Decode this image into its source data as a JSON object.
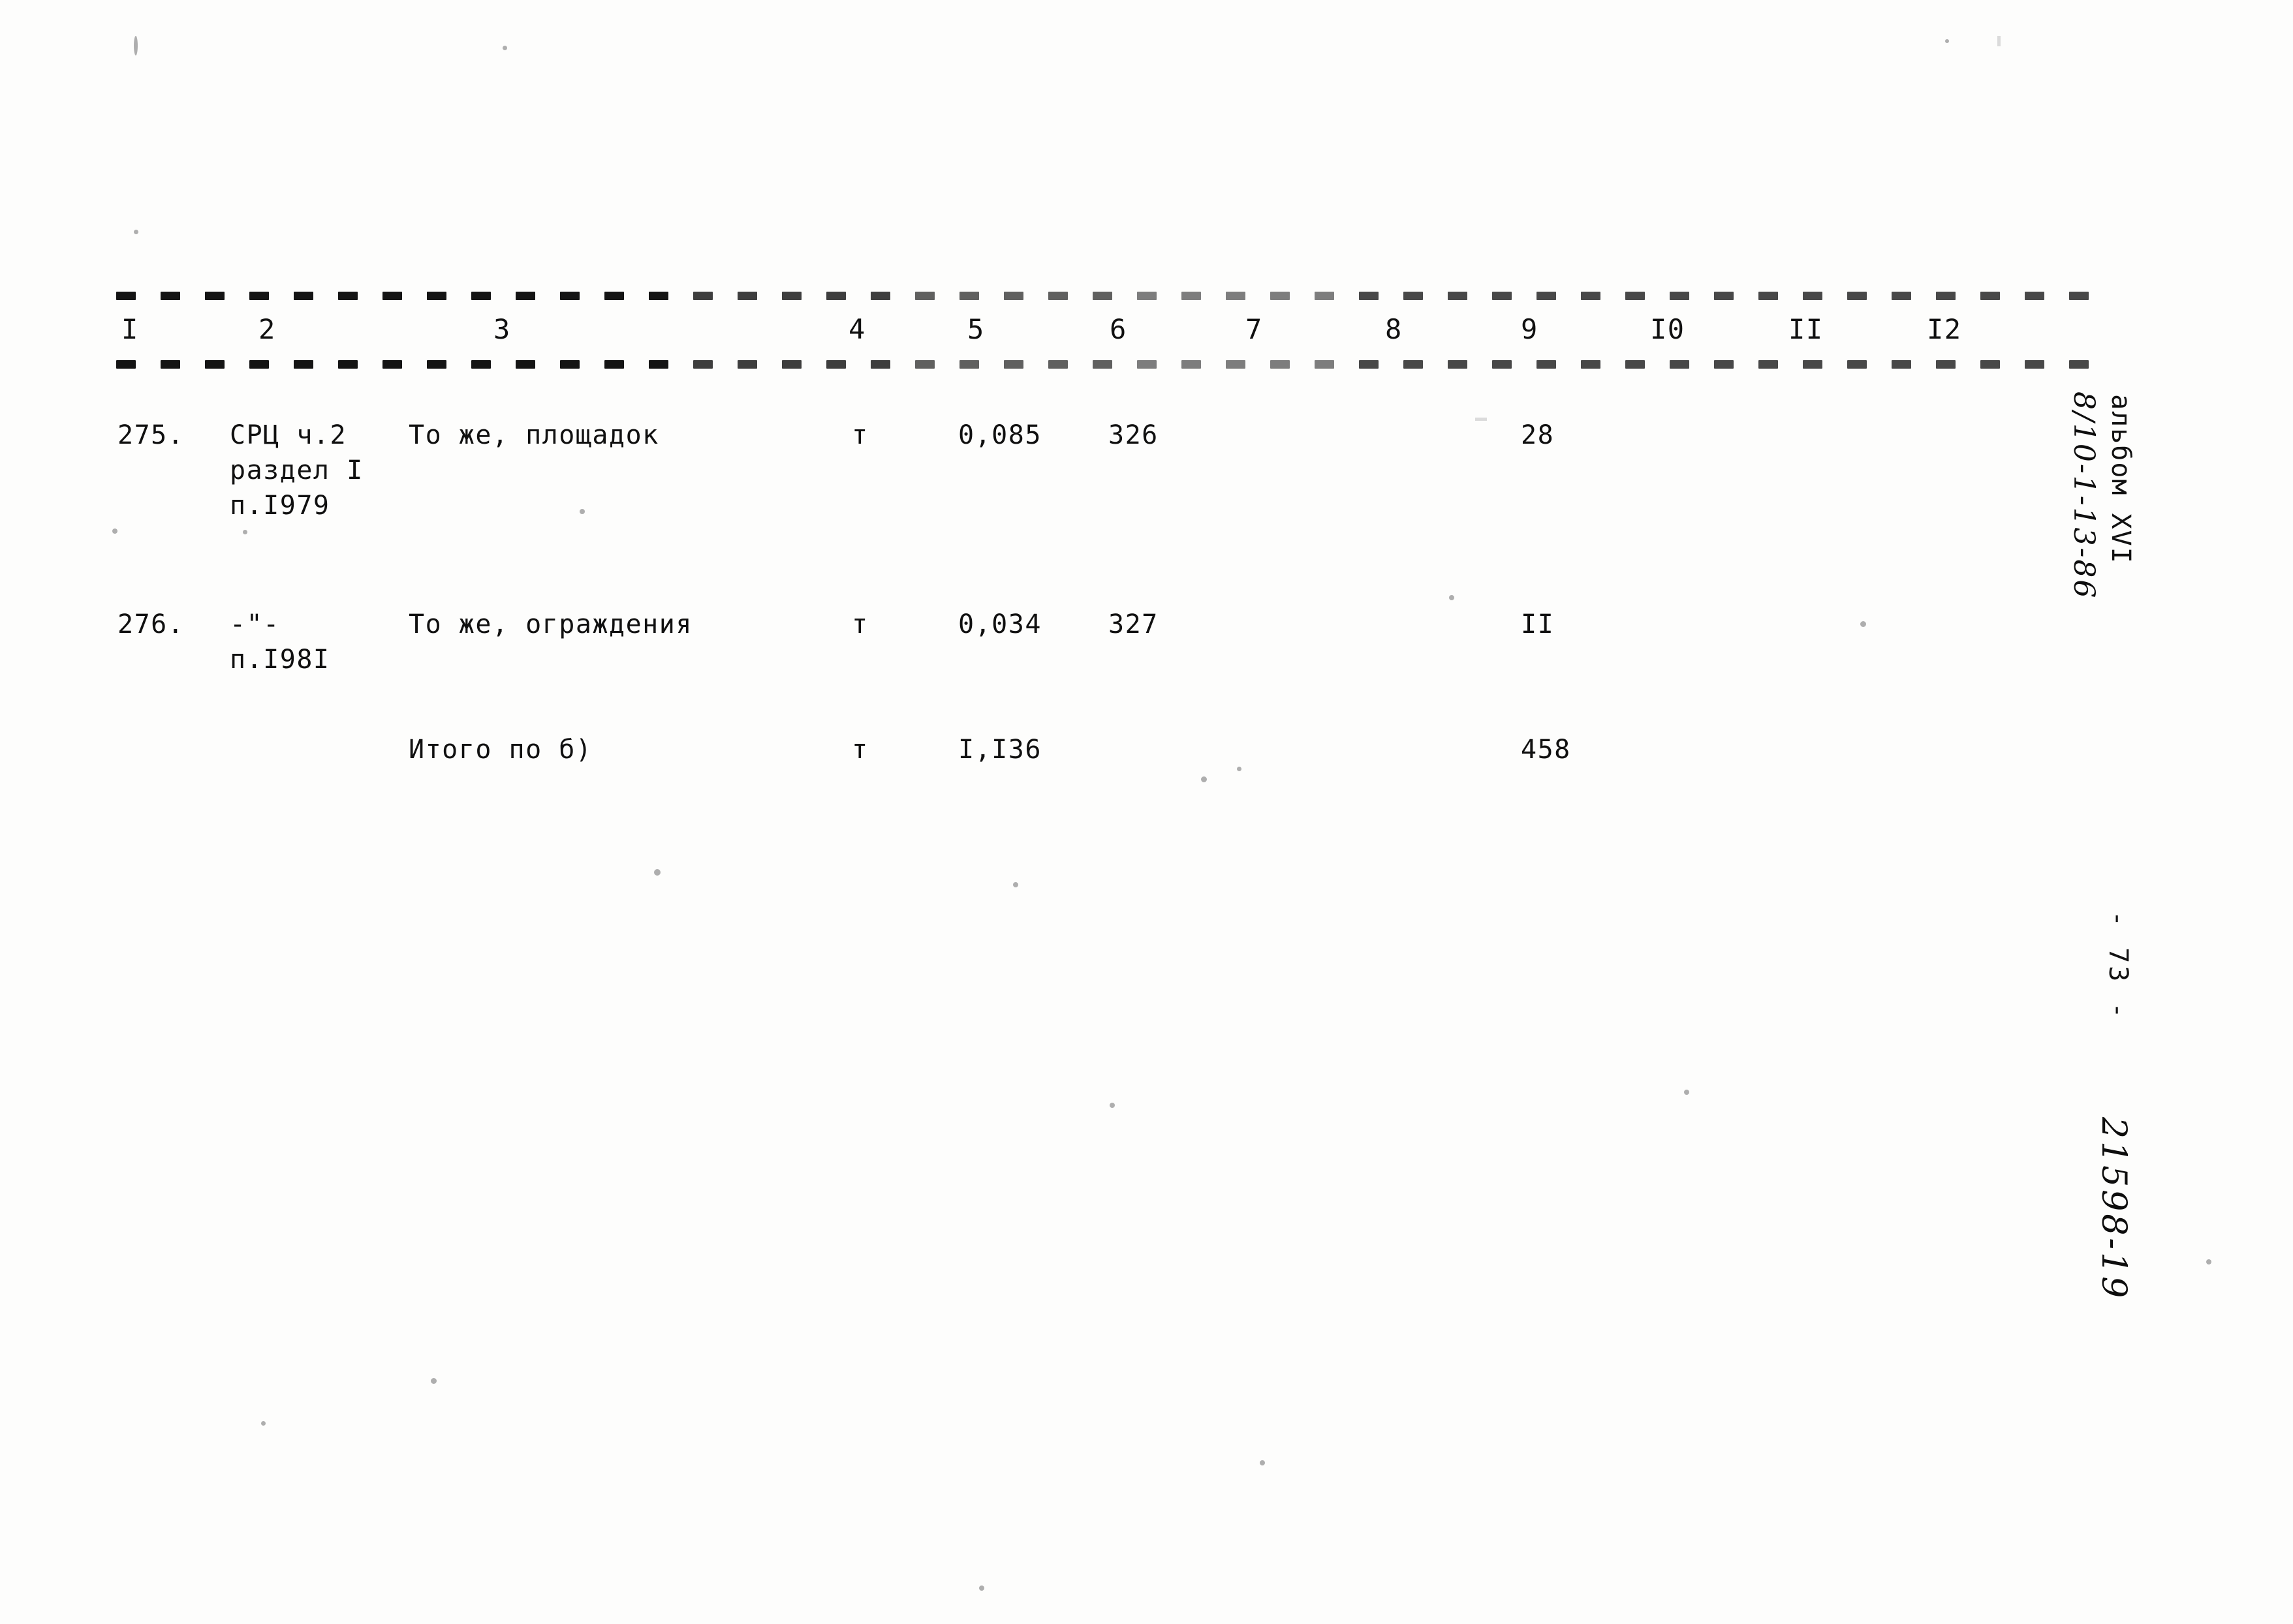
{
  "document": {
    "type": "scanned-estimate-table",
    "page_number": "- 73 -",
    "album_label": "альбом XVI",
    "handwritten_code": "8/10-1-13-86",
    "handwritten_doc_number": "21598-19"
  },
  "table": {
    "column_headers": [
      "I",
      "2",
      "3",
      "4",
      "5",
      "6",
      "7",
      "8",
      "9",
      "I0",
      "II",
      "I2"
    ],
    "rows": [
      {
        "num": "275.",
        "ref_lines": [
          "СРЦ ч.2",
          "раздел I",
          "п.I979"
        ],
        "name": "То же, площадок",
        "unit": "т",
        "c5": "0,085",
        "c6": "326",
        "c7": "",
        "c8": "",
        "c9": "28",
        "c10": "",
        "c11": "",
        "c12": ""
      },
      {
        "num": "276.",
        "ref_lines": [
          "-\"-",
          "п.I98I"
        ],
        "name": "То же, ограждения",
        "unit": "т",
        "c5": "0,034",
        "c6": "327",
        "c7": "",
        "c8": "",
        "c9": "II",
        "c10": "",
        "c11": "",
        "c12": ""
      },
      {
        "num": "",
        "ref_lines": [],
        "name": "Итого по б)",
        "unit": "т",
        "c5": "I,I36",
        "c6": "",
        "c7": "",
        "c8": "",
        "c9": "458",
        "c10": "",
        "c11": "",
        "c12": ""
      }
    ]
  }
}
